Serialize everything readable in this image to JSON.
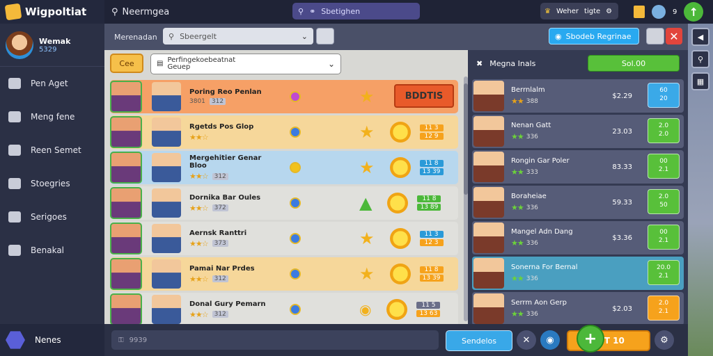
{
  "app": {
    "title": "Wigpoltiat",
    "screen_title": "Neermgea"
  },
  "top": {
    "search_label": "Sbetighen",
    "coins_label": "Weher",
    "coins_value": "tigte",
    "level": "9"
  },
  "sidebar": {
    "user": {
      "name": "Wemak",
      "id": "5329"
    },
    "items": [
      {
        "label": "Pen Aget",
        "icon": "shopping-icon"
      },
      {
        "label": "Meng fene",
        "icon": "pencil-icon"
      },
      {
        "label": "Reen Semet",
        "icon": "book-icon"
      },
      {
        "label": "Stoegries",
        "icon": "image-icon"
      },
      {
        "label": "Serigoes",
        "icon": "document-icon"
      },
      {
        "label": "Benakal",
        "icon": "search-icon"
      }
    ],
    "bottom": {
      "label": "Nenes"
    }
  },
  "subbar": {
    "label": "Merenadan",
    "search_placeholder": "Sbeergelt",
    "action_button": "Sbodeb Regrinae"
  },
  "filter": {
    "button": "Cee",
    "select_line1": "Perfingekoebeatnat",
    "select_line2": "Geuep"
  },
  "list": [
    {
      "name": "Poring Reo Penlan",
      "code": "3801",
      "badge": "312",
      "style": "orange",
      "price_top": "",
      "price_bottom": "",
      "cta": "BDDTIS"
    },
    {
      "name": "Rgetds Pos Glop",
      "code": "",
      "badge": "",
      "style": "yellow",
      "price_top": "11 3",
      "price_bottom": "12 9",
      "cta": ""
    },
    {
      "name": "Mergehitier Genar Bloo",
      "code": "",
      "badge": "312",
      "style": "blue",
      "price_top": "11 8",
      "price_bottom": "13 39",
      "cta": ""
    },
    {
      "name": "Dornika Bar Oules",
      "code": "",
      "badge": "372",
      "style": "plain",
      "price_top": "11 8",
      "price_bottom": "13 89",
      "cta": ""
    },
    {
      "name": "Aernsk Ranttri",
      "code": "",
      "badge": "373",
      "style": "plain",
      "price_top": "11 3",
      "price_bottom": "12 3",
      "cta": ""
    },
    {
      "name": "Pamai Nar Prdes",
      "code": "",
      "badge": "312",
      "style": "yellow",
      "price_top": "11 8",
      "price_bottom": "13 39",
      "cta": ""
    },
    {
      "name": "Donal Gury Pemarn",
      "code": "",
      "badge": "312",
      "style": "plain",
      "price_top": "11 5",
      "price_bottom": "13 63",
      "cta": ""
    }
  ],
  "right": {
    "header": "Megna Inals",
    "button": "Sol.00",
    "items": [
      {
        "name": "Berrnlalm",
        "rating": "388",
        "value": "$2.29",
        "top": "60",
        "bottom": "20",
        "color": "#3aa9e8",
        "hl": false
      },
      {
        "name": "Nenan Gatt",
        "rating": "336",
        "value": "23.03",
        "top": "2.0",
        "bottom": "2.0",
        "color": "#58c03a",
        "hl": false
      },
      {
        "name": "Rongin Gar Poler",
        "rating": "333",
        "value": "83.33",
        "top": "00",
        "bottom": "2.1",
        "color": "#58c03a",
        "hl": false
      },
      {
        "name": "Boraheiae",
        "rating": "336",
        "value": "59.33",
        "top": "2.0",
        "bottom": "50",
        "color": "#58c03a",
        "hl": false
      },
      {
        "name": "Mangel Adn Dang",
        "rating": "336",
        "value": "$3.36",
        "top": "00",
        "bottom": "2.1",
        "color": "#58c03a",
        "hl": false
      },
      {
        "name": "Sonerna For Bernal",
        "rating": "336",
        "value": "",
        "top": "20.0",
        "bottom": "2.1",
        "color": "#58c03a",
        "hl": true
      },
      {
        "name": "Serrm Aon Gerp",
        "rating": "336",
        "value": "$2.03",
        "top": "2.0",
        "bottom": "2.1",
        "color": "#f6a21c",
        "hl": false
      }
    ]
  },
  "bottom": {
    "chat_placeholder": "9939",
    "send": "Sendelos",
    "confirm": "00T 10"
  },
  "colors": {
    "accent": "#29a9f0",
    "primary_green": "#58c03a",
    "warning": "#f6a21c",
    "danger": "#e2453c"
  }
}
